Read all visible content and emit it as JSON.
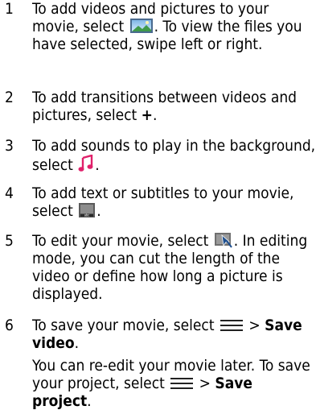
{
  "steps": [
    {
      "num": "1",
      "text_a": "To add videos and pictures to your movie, select ",
      "text_b": ". To view the files you have selected, swipe left or right.",
      "icon": "gallery-icon"
    },
    {
      "num": "2",
      "text_a": "To add transitions between videos and pictures, select ",
      "bold": "+",
      "text_b": "."
    },
    {
      "num": "3",
      "text_a": "To add sounds to play in the background, select ",
      "text_b": ".",
      "icon": "music-note-icon",
      "icon_color": "#e0206a"
    },
    {
      "num": "4",
      "text_a": "To add text or subtitles to your movie, select ",
      "text_b": ".",
      "icon": "text-abc-icon"
    },
    {
      "num": "5",
      "text_a": "To edit your movie, select ",
      "text_b": ". In editing mode, you can cut the length of the video or define how long a picture is displayed.",
      "icon": "edit-clip-icon"
    },
    {
      "num": "6",
      "text_a": "To save your movie, select ",
      "text_mid": " > ",
      "bold": "Save video",
      "text_b": ".",
      "icon": "menu-icon"
    }
  ],
  "note": {
    "text_a": "You can re-edit your movie later. To save your project, select ",
    "text_mid": " > ",
    "bold": "Save project",
    "text_b": ".",
    "icon": "menu-icon"
  }
}
